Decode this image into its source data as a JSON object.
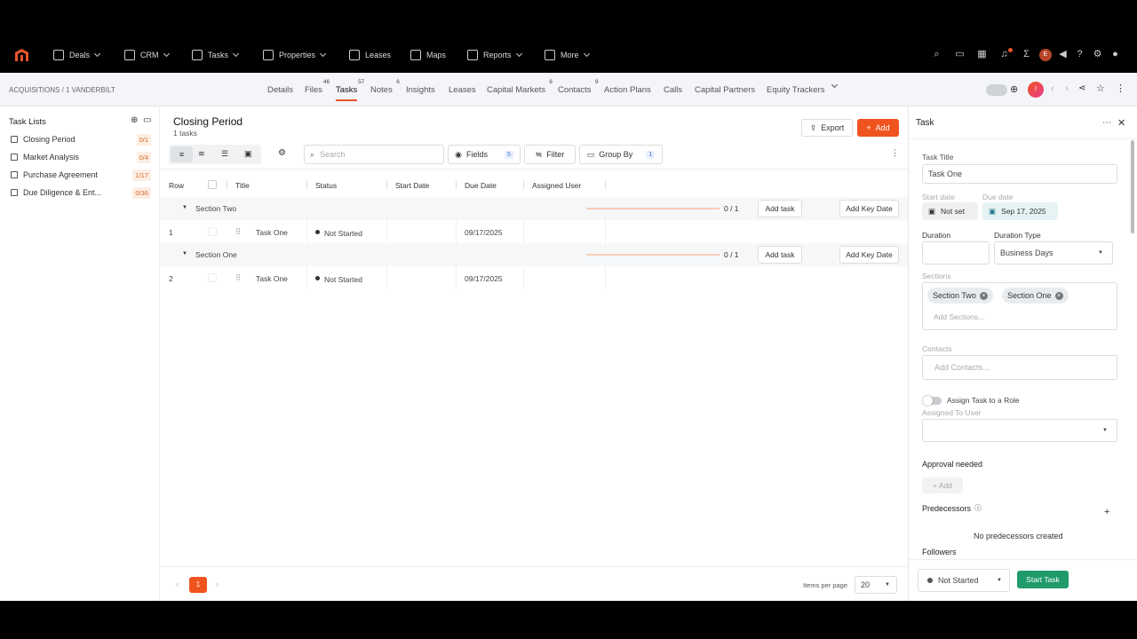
{
  "topnav": {
    "items": [
      {
        "label": "Deals",
        "icon": "deals-icon"
      },
      {
        "label": "CRM",
        "icon": "crm-icon"
      },
      {
        "label": "Tasks",
        "icon": "tasks-icon"
      },
      {
        "label": "Properties",
        "icon": "properties-icon"
      },
      {
        "label": "Leases",
        "icon": "leases-icon"
      },
      {
        "label": "Maps",
        "icon": "maps-icon"
      },
      {
        "label": "Reports",
        "icon": "reports-icon"
      },
      {
        "label": "More",
        "icon": "grid-icon"
      }
    ],
    "avatar_initial": "E"
  },
  "subbar": {
    "breadcrumb": "ACQUISITIONS / 1 VANDERBILT",
    "tabs": [
      {
        "label": "Details"
      },
      {
        "label": "Files",
        "badge": "46"
      },
      {
        "label": "Tasks",
        "badge": "57"
      },
      {
        "label": "Notes",
        "badge": "6"
      },
      {
        "label": "Insights"
      },
      {
        "label": "Leases"
      },
      {
        "label": "Capital Markets",
        "badge": "6"
      },
      {
        "label": "Contacts",
        "badge": "9"
      },
      {
        "label": "Action Plans"
      },
      {
        "label": "Calls"
      },
      {
        "label": "Capital Partners"
      },
      {
        "label": "Equity Trackers"
      }
    ],
    "avatar_initial": "I"
  },
  "left": {
    "title": "Task Lists",
    "lists": [
      {
        "label": "Closing Period",
        "count": "0/1"
      },
      {
        "label": "Market Analysis",
        "count": "0/4"
      },
      {
        "label": "Purchase Agreement",
        "count": "1/17"
      },
      {
        "label": "Due Diligence & Ent...",
        "count": "0/36"
      }
    ]
  },
  "main": {
    "title": "Closing Period",
    "subtitle": "1 tasks",
    "export_label": "Export",
    "add_label": "Add",
    "search_placeholder": "Search",
    "fields_label": "Fields",
    "fields_count": "5",
    "filter_label": "Filter",
    "groupby_label": "Group By",
    "groupby_count": "1",
    "columns": [
      "Row",
      "Title",
      "Status",
      "Start Date",
      "Due Date",
      "Assigned User"
    ],
    "sections": [
      {
        "name": "Section Two",
        "progress": "0 / 1",
        "progress_fraction": 0,
        "add_task": "Add task",
        "add_key_date": "Add Key Date",
        "rows": [
          {
            "row": "1",
            "title": "Task One",
            "status": "Not Started",
            "start": "",
            "due": "09/17/2025",
            "user": ""
          }
        ]
      },
      {
        "name": "Section One",
        "progress": "0 / 1",
        "progress_fraction": 0,
        "add_task": "Add task",
        "add_key_date": "Add Key Date",
        "rows": [
          {
            "row": "2",
            "title": "Task One",
            "status": "Not Started",
            "start": "",
            "due": "09/17/2025",
            "user": ""
          }
        ]
      }
    ],
    "pagination": {
      "page": "1",
      "items_per_page_label": "Items per page",
      "items_per_page": "20"
    }
  },
  "right": {
    "header": "Task",
    "task_title_label": "Task Title",
    "task_title": "Task One",
    "start_date_label": "Start date",
    "start_date": "Not set",
    "due_date_label": "Due date",
    "due_date": "Sep 17, 2025",
    "duration_label": "Duration",
    "duration_value": "",
    "duration_type_label": "Duration Type",
    "duration_type": "Business Days",
    "sections_label": "Sections",
    "sections": [
      "Section Two",
      "Section One"
    ],
    "add_sections_placeholder": "Add Sections...",
    "contacts_label": "Contacts",
    "add_contacts_placeholder": "Add Contacts...",
    "assign_role_label": "Assign Task to a Role",
    "assigned_user_label": "Assigned To User",
    "approval_label": "Approval needed",
    "approval_add": "+ Add",
    "predecessors_label": "Predecessors",
    "no_predecessors": "No predecessors created",
    "followers_label": "Followers",
    "status_select": "Not Started",
    "start_task_label": "Start Task"
  },
  "colors": {
    "accent": "#f0541e",
    "success": "#1f9a6b",
    "brand_logo": "#e8542b"
  }
}
